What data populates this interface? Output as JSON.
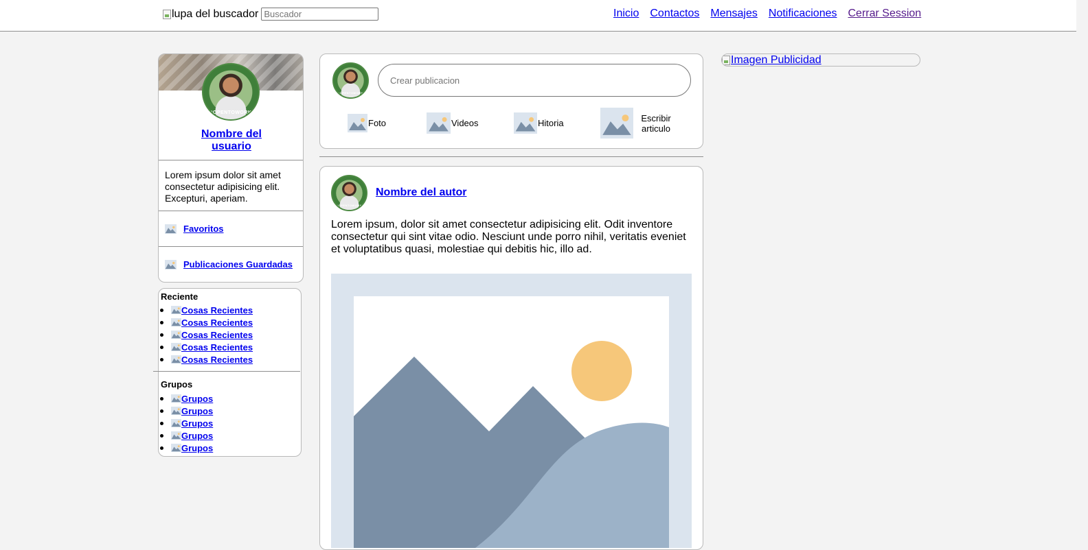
{
  "header": {
    "search_icon_alt": "lupa del buscador",
    "search_placeholder": "Buscador",
    "nav": [
      {
        "label": "Inicio"
      },
      {
        "label": "Contactos"
      },
      {
        "label": "Mensajes"
      },
      {
        "label": "Notificaciones"
      },
      {
        "label": "Cerrar Session"
      }
    ]
  },
  "profile": {
    "badge_text": "#OPENTOWORK",
    "name": "Nombre del usuario",
    "description": "Lorem ipsum dolor sit amet consectetur adipisicing elit. Excepturi, aperiam.",
    "links": [
      {
        "label": "Favoritos",
        "icon": "image-placeholder-icon"
      },
      {
        "label": "Publicaciones Guardadas",
        "icon": "image-placeholder-icon"
      }
    ]
  },
  "sidebar": {
    "recent_title": "Reciente",
    "recent_items": [
      "Cosas Recientes",
      "Cosas Recientes",
      "Cosas Recientes",
      "Cosas Recientes",
      "Cosas Recientes"
    ],
    "groups_title": "Grupos",
    "group_items": [
      "Grupos",
      "Grupos",
      "Grupos",
      "Grupos",
      "Grupos"
    ]
  },
  "composer": {
    "placeholder": "Crear publicacion",
    "actions": [
      {
        "label": "Foto",
        "icon": "image-placeholder-icon"
      },
      {
        "label": "Videos",
        "icon": "image-placeholder-icon"
      },
      {
        "label": "Hitoria",
        "icon": "image-placeholder-icon"
      },
      {
        "label": "Escribir articulo",
        "icon": "image-placeholder-icon"
      }
    ]
  },
  "post": {
    "author": "Nombre del autor",
    "text": "Lorem ipsum, dolor sit amet consectetur adipisicing elit. Odit inventore consectetur qui sint vitae odio. Nesciunt unde porro nihil, veritatis eveniet et voluptatibus quasi, molestiae qui debitis hic, illo ad."
  },
  "ad": {
    "alt": "Imagen Publicidad"
  },
  "colors": {
    "link": "#0000ee",
    "visited": "#551a8b",
    "placeholder_bg": "#dbe4ee",
    "mountain_dark": "#7a8fa6",
    "mountain_light": "#9cb2c8",
    "sun": "#f6c77a"
  }
}
